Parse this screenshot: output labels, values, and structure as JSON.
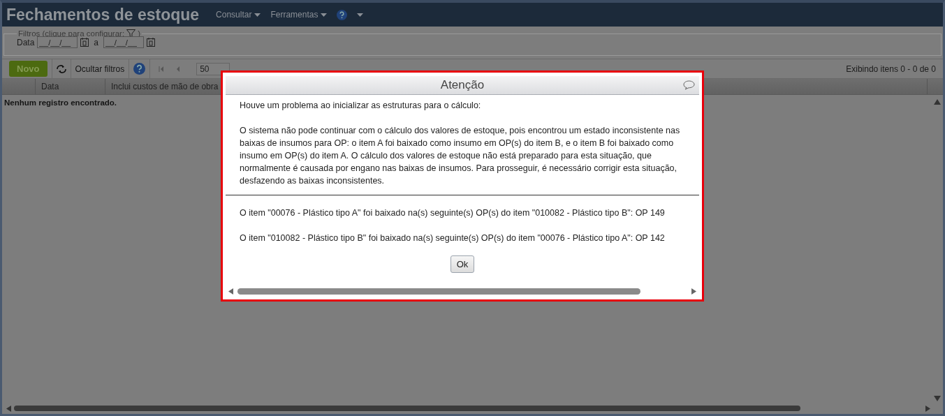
{
  "app_title": "Fechamentos de estoque",
  "menu": [
    {
      "label": "Consultar"
    },
    {
      "label": "Ferramentas"
    }
  ],
  "filters": {
    "legend": "Filtros (clique para configurar:",
    "legend_end": ")",
    "date_label": "Data",
    "date_from": "__/__/__",
    "separator": "a",
    "date_to": "__/__/__"
  },
  "toolbar": {
    "new_button": "Novo",
    "hide_filters": "Ocultar filtros",
    "page_size": "50",
    "count": "Exibindo itens 0 - 0 de 0"
  },
  "table": {
    "columns": [
      "Data",
      "Inclui custos de mão de obra"
    ],
    "empty": "Nenhum registro encontrado."
  },
  "dialog": {
    "title": "Atenção",
    "intro": "Houve um problema ao inicializar as estruturas para o cálculo:",
    "message": "O sistema não pode continuar com o cálculo dos valores de estoque, pois encontrou um estado inconsistente nas baixas de insumos para OP: o item A foi baixado como insumo em OP(s) do item B, e o item B foi baixado como insumo em OP(s) do item A. O cálculo dos valores de estoque não está preparado para esta situação, que normalmente é causada por engano nas baixas de insumos. Para prosseguir, é necessário corrigir esta situação, desfazendo as baixas inconsistentes.",
    "details": [
      "O item \"00076 - Plástico tipo A\" foi baixado na(s) seguinte(s) OP(s) do item \"010082 - Plástico tipo B\": OP 149",
      "O item \"010082 - Plástico tipo B\" foi baixado na(s) seguinte(s) OP(s) do item \"00076 - Plástico tipo A\": OP 142"
    ],
    "ok_button": "Ok"
  }
}
